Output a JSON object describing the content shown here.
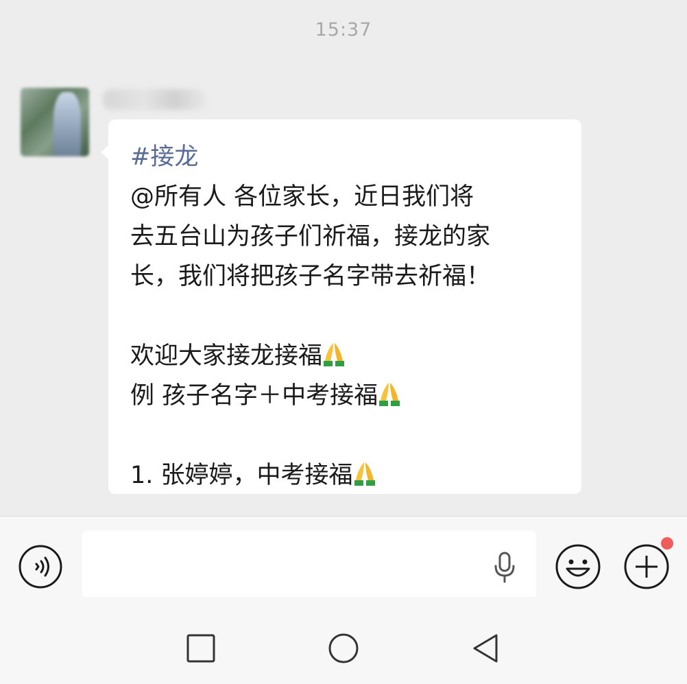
{
  "chat": {
    "timestamp": "15:37",
    "message": {
      "tag": "#接龙",
      "lines": [
        "@所有人  各位家长，近日我们将",
        "去五台山为孩子们祈福，接龙的家",
        "长，我们将把孩子名字带去祈福！",
        "",
        "欢迎大家接龙接福",
        "例 孩子名字＋中考接福",
        "",
        "1. 张婷婷，中考接福"
      ]
    }
  },
  "input_bar": {
    "voice_icon": "voice-icon",
    "mic_icon": "microphone-icon",
    "emoji_icon": "emoji-smile-icon",
    "plus_icon": "plus-circle-icon",
    "badge_color": "#f15b5b"
  },
  "nav": {
    "recents_icon": "square-icon",
    "home_icon": "circle-icon",
    "back_icon": "back-triangle-icon"
  },
  "colors": {
    "background": "#ededed",
    "bubble": "#ffffff",
    "tag": "#576b95"
  }
}
